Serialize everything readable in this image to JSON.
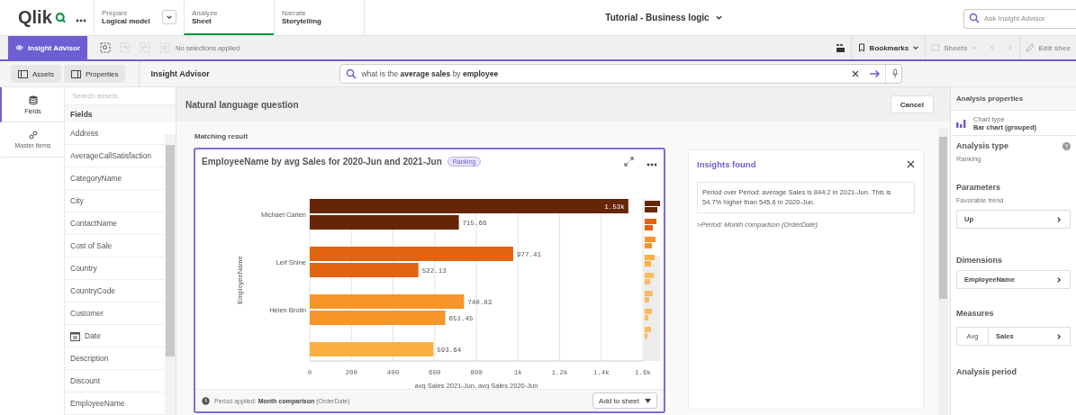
{
  "topbar": {
    "logo": "Qlik",
    "tabs": [
      {
        "kind": "dropdown",
        "caption": "Prepare",
        "label": "Logical model",
        "selected": false
      },
      {
        "kind": "plain",
        "caption": "Analyze",
        "label": "Sheet",
        "selected": true
      },
      {
        "kind": "plain",
        "caption": "Narrate",
        "label": "Storytelling",
        "selected": false
      }
    ],
    "app_title": "Tutorial - Business logic",
    "search": {
      "placeholder": "Ask Insight Advisor"
    }
  },
  "toolbar": {
    "insight_button": "Insight Advisor",
    "selection_status": "No selections applied",
    "right_items": [
      {
        "label": "Bookmarks",
        "disabled": false
      },
      {
        "label": "Sheets",
        "disabled": true
      }
    ],
    "edit": "Edit shee"
  },
  "subbar": {
    "buttons": [
      "Assets",
      "Properties"
    ],
    "title": "Insight Advisor",
    "query": "what is the **average sales** by **employee**"
  },
  "nav": [
    {
      "kind": "fields",
      "label": "Fields",
      "selected": true
    },
    {
      "kind": "master",
      "label": "Master items",
      "selected": false
    }
  ],
  "assets": {
    "placeholder": "Search assets",
    "header": "Fields",
    "items": [
      {
        "kind": "text",
        "label": "Address"
      },
      {
        "kind": "text",
        "label": "AverageCallSatisfaction"
      },
      {
        "kind": "text",
        "label": "CategoryName"
      },
      {
        "kind": "text",
        "label": "City"
      },
      {
        "kind": "text",
        "label": "ContactName"
      },
      {
        "kind": "text",
        "label": "Cost of Sale"
      },
      {
        "kind": "text",
        "label": "Country"
      },
      {
        "kind": "text",
        "label": "CountryCode"
      },
      {
        "kind": "text",
        "label": "Customer"
      },
      {
        "kind": "date",
        "label": "Date"
      },
      {
        "kind": "text",
        "label": "Description"
      },
      {
        "kind": "text",
        "label": "Discount"
      },
      {
        "kind": "text",
        "label": "EmployeeName"
      }
    ]
  },
  "center": {
    "header": "Natural language question",
    "cancel": "Cancel",
    "section": "Matching result",
    "card": {
      "title": "EmployeeName by avg Sales for 2020-Jun and 2021-Jun",
      "badge": "Ranking",
      "chart_data": {
        "type": "bar",
        "orientation": "horizontal",
        "grid": true,
        "xlabel": "avg Sales 2021-Jun, avg Sales 2020-Jun",
        "ylabel": "EmployeeName",
        "categories": [
          "Michael Carlen",
          "Leif Shine",
          "Helen Brolin",
          null
        ],
        "series": [
          {
            "colors": [
              "#662506",
              "#e3640f",
              "#f7952a",
              "#fbb040"
            ],
            "values": [
              1530,
              977,
              741,
              594
            ]
          },
          {
            "colors": [
              "#662506",
              "#e3640f",
              "#f7952a",
              null
            ],
            "values": [
              716,
              522,
              651,
              null
            ]
          }
        ],
        "value_labels": [
          [
            "1.53k",
            "977.41",
            "740.83",
            "593.64"
          ],
          [
            "715.66",
            "522.13",
            "651.45",
            null
          ]
        ],
        "xlim": [
          0,
          1600
        ],
        "xticks": [
          0,
          200,
          400,
          600,
          800,
          {
            "value": 1000,
            "label": "1k"
          },
          {
            "value": 1200,
            "label": "1.2k"
          },
          {
            "value": 1400,
            "label": "1.4k"
          },
          {
            "value": 1600,
            "label": "1.6k"
          }
        ]
      },
      "footer": "Period applied: **Month comparison** (OrderDate)",
      "add_button": "Add to sheet"
    },
    "insights": {
      "title": "Insights found",
      "text": "Period over Period: average Sales is 844.2 in 2021-Jun. This is 54.7% higher than 545.6 in 2020-Jun.",
      "note": ">Period: Month comparison (OrderDate)"
    }
  },
  "properties": {
    "header": "Analysis properties",
    "chart_type_label": "Chart type",
    "chart_type": "Bar chart (grouped)",
    "analysis_type": "Analysis type",
    "analysis_value": "Ranking",
    "parameters": "Parameters",
    "trend_label": "Favorable trend",
    "trend": "Up",
    "dimensions": "Dimensions",
    "dimension": "EmployeeName",
    "measures": "Measures",
    "aggregation": "Avg",
    "measure": "Sales",
    "period": "Analysis period"
  }
}
